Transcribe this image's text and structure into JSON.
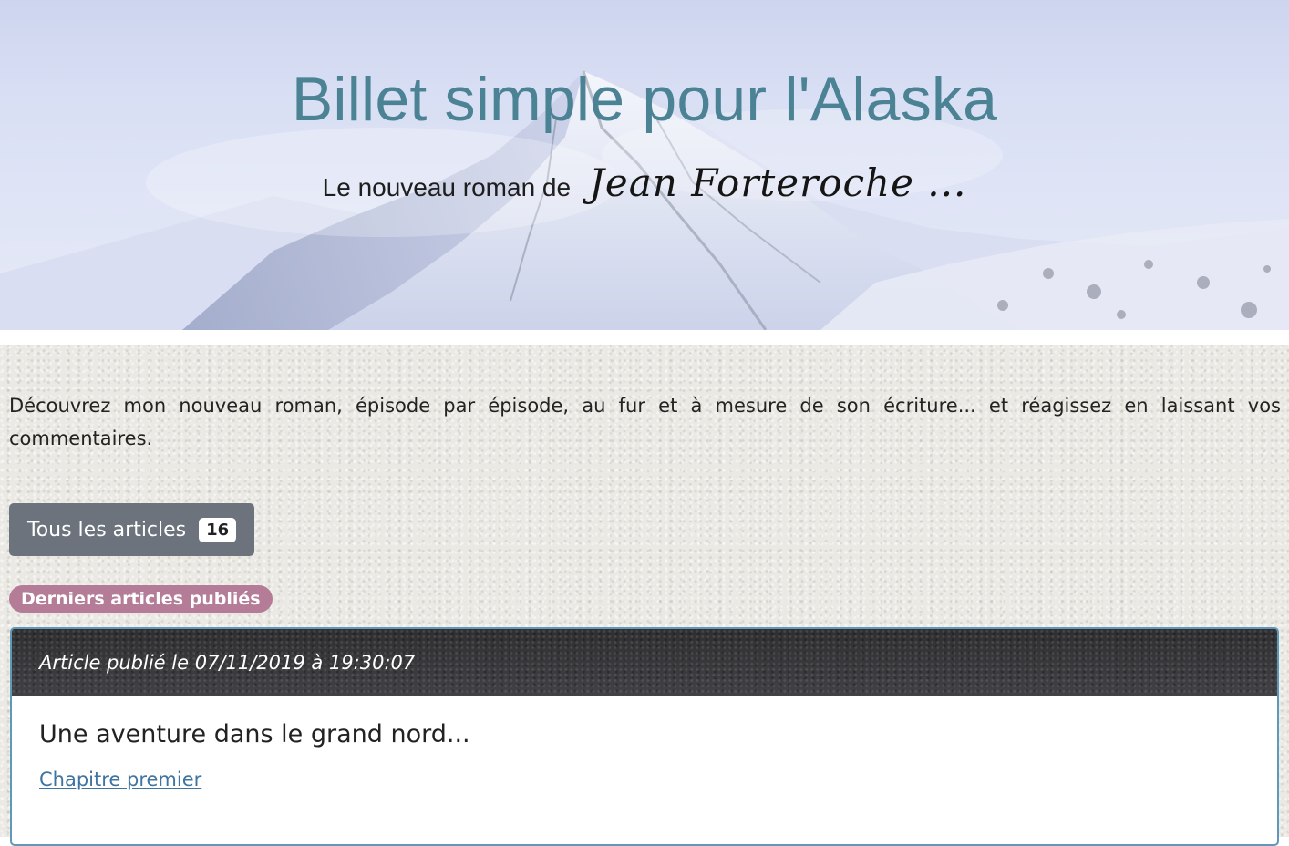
{
  "header": {
    "title": "Billet simple pour l'Alaska",
    "subtitle_prefix": "Le nouveau roman de",
    "author_signature": "Jean Forteroche ..."
  },
  "main": {
    "intro": "Découvrez mon nouveau roman, épisode par épisode, au fur et à mesure de son écriture... et réagissez en laissant vos commentaires.",
    "all_articles": {
      "label": "Tous les articles",
      "count": "16"
    },
    "latest_badge": "Derniers articles publiés",
    "article": {
      "date": "Article publié le 07/11/2019 à 19:30:07",
      "title": "Une aventure dans le grand nord...",
      "link": "Chapitre premier"
    }
  },
  "colors": {
    "title": "#4b8294",
    "button": "#6c737c",
    "badge": "#b57c97",
    "card_border": "#5f98b8",
    "link": "#3f74a0"
  },
  "icons": {
    "hero_image": "snowy-mountain-peak"
  }
}
